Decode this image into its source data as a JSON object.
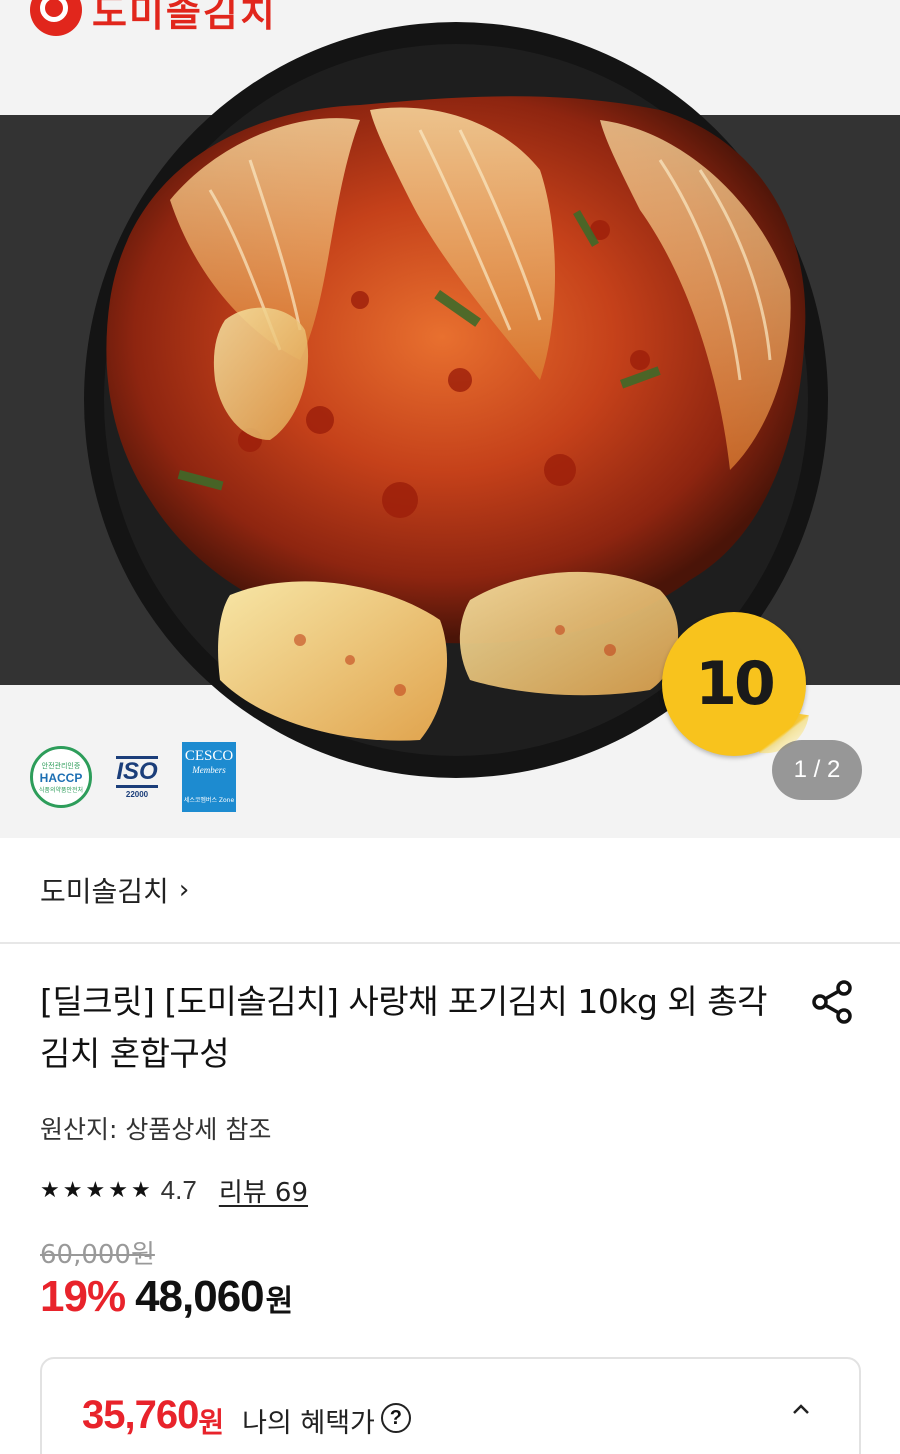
{
  "brand": {
    "logo_text": "도미솔김치",
    "primary_color": "#e1261c"
  },
  "hero": {
    "badge_text": "10",
    "counter_text": "1 / 2",
    "certifications": {
      "haccp_top": "안전관리인증",
      "haccp_main": "HACCP",
      "haccp_bottom": "식품의약품안전처",
      "iso_main": "ISO",
      "iso_number": "22000",
      "cesco_title": "CESCO",
      "cesco_sub": "Members",
      "cesco_bottom": "세스코멤버스 Zone"
    }
  },
  "store": {
    "name": "도미솔김치",
    "chevron": "›"
  },
  "product": {
    "title": "[딜크릿] [도미솔김치] 사랑채 포기김치 10kg 외 총각김치 혼합구성",
    "origin": "원산지: 상품상세 참조",
    "rating": {
      "score": "4.7",
      "reviews": "리뷰 69",
      "stars": 4.7
    },
    "original_price": "60,000원",
    "discount": "19%",
    "price": "48,060",
    "won": "원",
    "accent_color": "#e8232b"
  },
  "benefit": {
    "price": "35,760",
    "won": "원",
    "label": "나의 혜택가",
    "help": "?"
  }
}
